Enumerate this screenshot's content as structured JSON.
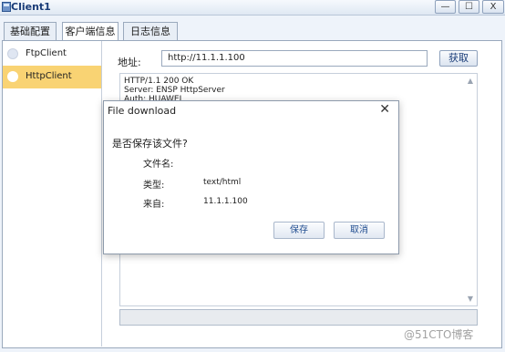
{
  "window": {
    "title": "Client1",
    "minimize_glyph": "—",
    "maximize_glyph": "☐",
    "close_glyph": "X"
  },
  "tabs": [
    {
      "label": "基础配置",
      "active": false
    },
    {
      "label": "客户端信息",
      "active": true
    },
    {
      "label": "日志信息",
      "active": false
    }
  ],
  "sidebar": {
    "items": [
      {
        "label": "FtpClient",
        "selected": false
      },
      {
        "label": "HttpClient",
        "selected": true
      }
    ]
  },
  "address": {
    "label": "地址:",
    "value": "http://11.1.1.100",
    "fetch_label": "获取"
  },
  "response": {
    "lines": [
      "HTTP/1.1 200 OK",
      "Server: ENSP HttpServer",
      "Auth: HUAWEI"
    ]
  },
  "dialog": {
    "title": "File download",
    "close_glyph": "✕",
    "question": "是否保存该文件?",
    "fields": [
      {
        "key": "文件名:",
        "value": ""
      },
      {
        "key": "类型:",
        "value": "text/html"
      },
      {
        "key": "来自:",
        "value": "11.1.1.100"
      }
    ],
    "save_label": "保存",
    "cancel_label": "取消"
  },
  "watermark": "@51CTO博客",
  "colors": {
    "selection": "#f9d373",
    "accent_text": "#1a3c78"
  },
  "icons": {
    "app": "app-window-icon",
    "scroll_up": "scroll-up-arrow-icon",
    "scroll_down": "scroll-down-arrow-icon"
  }
}
